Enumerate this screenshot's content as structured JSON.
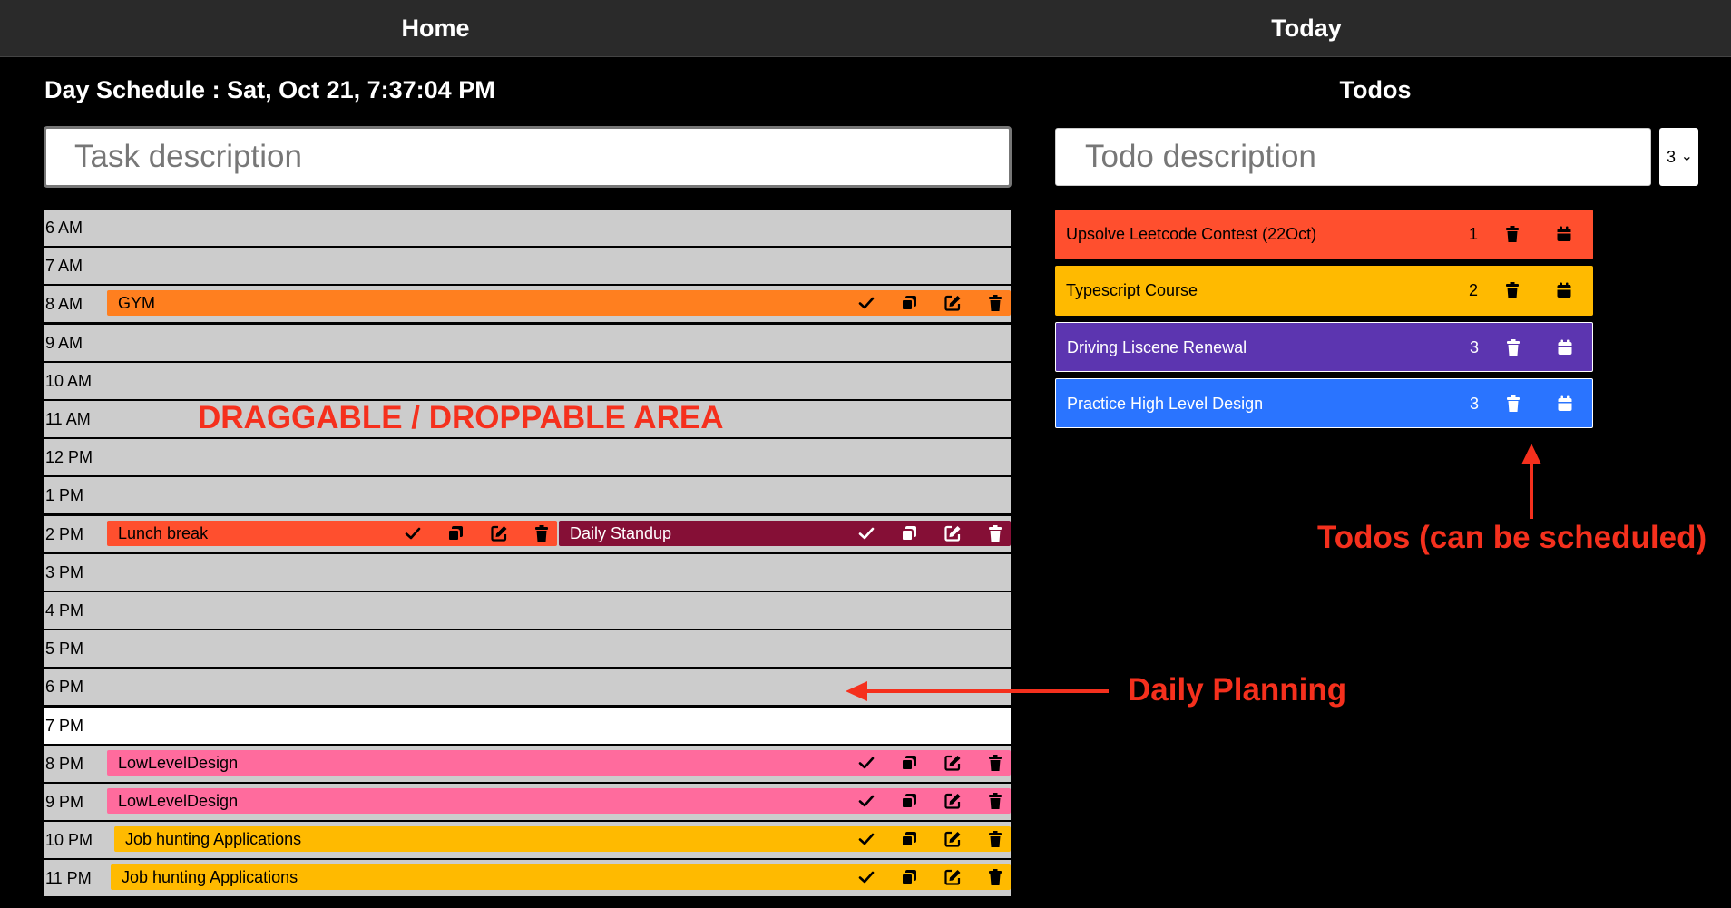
{
  "nav": {
    "home": "Home",
    "today": "Today"
  },
  "schedule": {
    "title": "Day Schedule : Sat, Oct 21, 7:37:04 PM",
    "input_placeholder": "Task description",
    "hours": [
      "6 AM",
      "7 AM",
      "8 AM",
      "9 AM",
      "10 AM",
      "11 AM",
      "12 PM",
      "1 PM",
      "2 PM",
      "3 PM",
      "4 PM",
      "5 PM",
      "6 PM",
      "7 PM",
      "8 PM",
      "9 PM",
      "10 PM",
      "11 PM"
    ],
    "tasks": [
      {
        "hour": "8 AM",
        "label": "GYM",
        "color": "#ff7f1f"
      },
      {
        "hour": "2 PM",
        "label": "Lunch break",
        "color": "#ff4f2e"
      },
      {
        "hour": "2 PM",
        "label": "Daily Standup",
        "color": "#850f36"
      },
      {
        "hour": "8 PM",
        "label": "LowLevelDesign",
        "color": "#ff6b9d"
      },
      {
        "hour": "9 PM",
        "label": "LowLevelDesign",
        "color": "#ff6b9d"
      },
      {
        "hour": "10 PM",
        "label": "Job hunting Applications",
        "color": "#ffba00"
      },
      {
        "hour": "11 PM",
        "label": "Job hunting Applications",
        "color": "#ffba00"
      }
    ],
    "current_hour_color": "#ffffff",
    "slot_color": "#cccccc"
  },
  "todos": {
    "title": "Todos",
    "input_placeholder": "Todo description",
    "priority_selected": "3",
    "items": [
      {
        "label": "Upsolve Leetcode Contest (22Oct)",
        "priority": "1",
        "color": "#ff4f2e"
      },
      {
        "label": "Typescript Course",
        "priority": "2",
        "color": "#ffba00"
      },
      {
        "label": "Driving Liscene Renewal",
        "priority": "3",
        "color": "#5c35b0"
      },
      {
        "label": "Practice High Level Design",
        "priority": "3",
        "color": "#2a74ff"
      }
    ]
  },
  "annotations": {
    "drag_area": "DRAGGABLE / DROPPABLE AREA",
    "daily_planning": "Daily Planning",
    "todos_note": "Todos (can be scheduled)",
    "color": "#f5301d"
  }
}
